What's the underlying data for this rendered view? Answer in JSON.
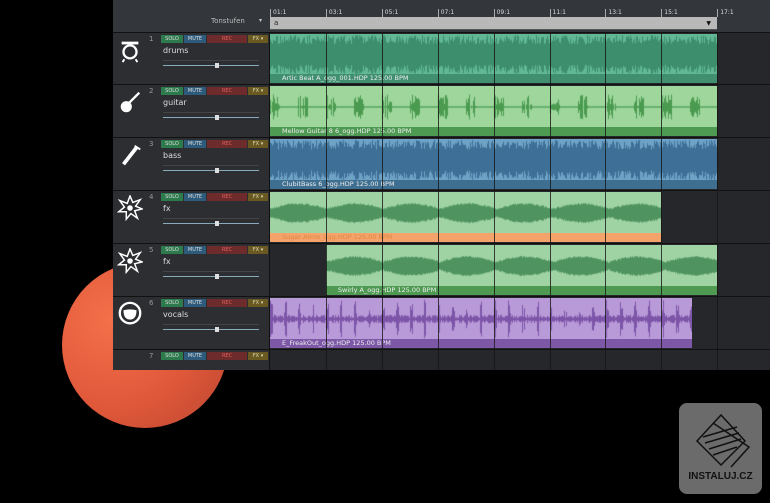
{
  "header": {
    "scale_label": "Tonstufen",
    "scale_value": "a"
  },
  "timeline": [
    "01:1",
    "03:1",
    "05:1",
    "07:1",
    "09:1",
    "11:1",
    "13:1",
    "15:1",
    "17:1"
  ],
  "buttons": {
    "solo": "SOLO",
    "mute": "MUTE",
    "rec": "REC",
    "fx": "FX ▾"
  },
  "tracks": [
    {
      "num": "1",
      "name": "drums",
      "icon": "drum-icon",
      "clip": "Artic Beat A_ogg_001.HDP  125.00 BPM",
      "color": "#62b894",
      "label_color": "#3f8f70"
    },
    {
      "num": "2",
      "name": "guitar",
      "icon": "guitar-icon",
      "clip": "Mellow Guitar 8 6_ogg.HDP  125.00 BPM",
      "color": "#9ed69c",
      "label_color": "#4e9a52"
    },
    {
      "num": "3",
      "name": "bass",
      "icon": "bass-icon",
      "clip": "ClubitBass 6_ogg.HDP  125.00 BPM",
      "color": "#6fa3c6",
      "label_color": "#3f6f90"
    },
    {
      "num": "4",
      "name": "fx",
      "icon": "explosion-icon",
      "clip": "Sugar Atmo_ogg.HDP  125.00 BPM",
      "color": "#9fd3a3",
      "label_color": "#f4a36b"
    },
    {
      "num": "5",
      "name": "fx",
      "icon": "explosion-icon",
      "clip": "Swirly A_ogg.HDP  125.00 BPM",
      "color": "#9fd3a3",
      "label_color": "#4e9a52"
    },
    {
      "num": "6",
      "name": "vocals",
      "icon": "mouth-icon",
      "clip": "E_FreakOut_ogg.HDP  125.00 BPM",
      "color": "#b99ad8",
      "label_color": "#7c58a6"
    },
    {
      "num": "7",
      "name": "",
      "icon": "empty-icon",
      "clip": "",
      "color": "",
      "label_color": ""
    }
  ],
  "watermark": "INSTALUJ.CZ"
}
